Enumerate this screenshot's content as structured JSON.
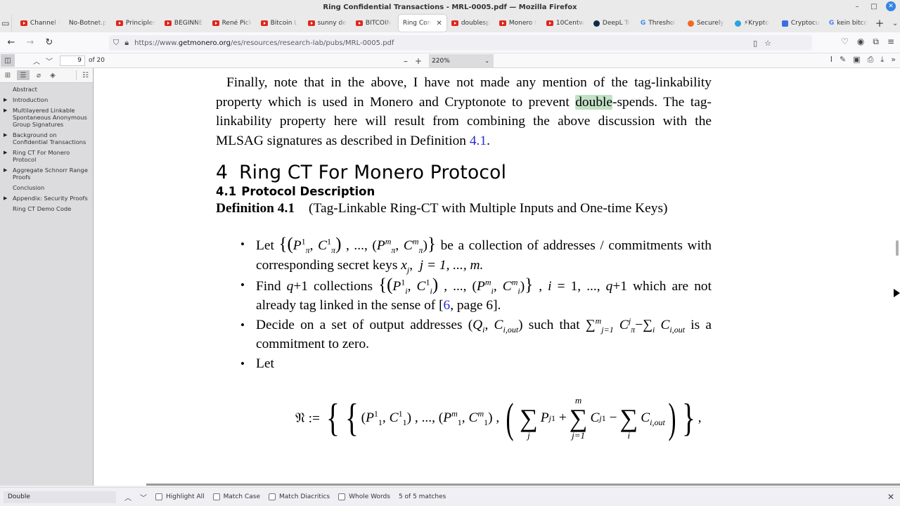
{
  "window": {
    "title": "Ring Confidential Transactions - MRL-0005.pdf — Mozilla Firefox",
    "controls": {
      "minimize": "–",
      "maximize": "□",
      "close": "✕"
    }
  },
  "tabs": [
    {
      "label": "Channel c",
      "icon": "youtube-icon",
      "active": false
    },
    {
      "label": "No-Botnet.p",
      "icon": "none",
      "active": false
    },
    {
      "label": "Principles",
      "icon": "youtube-icon",
      "active": false
    },
    {
      "label": "BEGINNE",
      "icon": "youtube-icon",
      "active": false
    },
    {
      "label": "René Pick",
      "icon": "youtube-icon",
      "active": false
    },
    {
      "label": "Bitcoin L",
      "icon": "youtube-icon",
      "active": false
    },
    {
      "label": "sunny de",
      "icon": "youtube-icon",
      "active": false
    },
    {
      "label": "BITCOIN",
      "icon": "youtube-icon",
      "active": false
    },
    {
      "label": "Ring Confi",
      "icon": "none",
      "active": true
    },
    {
      "label": "doublesp",
      "icon": "youtube-icon",
      "active": false
    },
    {
      "label": "Monero f",
      "icon": "youtube-icon",
      "active": false
    },
    {
      "label": "10Centw",
      "icon": "youtube-icon",
      "active": false
    },
    {
      "label": "DeepL Tr",
      "icon": "deepl-icon",
      "active": false
    },
    {
      "label": "Threshol",
      "icon": "google-icon",
      "active": false
    },
    {
      "label": "Securely",
      "icon": "monero-icon",
      "active": false
    },
    {
      "label": "⚡Krypto",
      "icon": "telegram-icon",
      "active": false
    },
    {
      "label": "Cryptocu",
      "icon": "cryptocurrency-icon",
      "active": false
    },
    {
      "label": "kein bitco",
      "icon": "google-icon",
      "active": false
    }
  ],
  "tab_close": "✕",
  "new_tab": "+",
  "tab_menu": "⌄",
  "nav": {
    "back": "←",
    "forward": "→",
    "reload": "↻",
    "url_prefix": "https://www.",
    "url_domain": "getmonero.org",
    "url_path": "/es/resources/research-lab/pubs/MRL-0005.pdf"
  },
  "pdf_toolbar": {
    "page_current": "9",
    "page_total_label": "of 20",
    "zoom_minus": "–",
    "zoom_plus": "+",
    "zoom_value": "220%"
  },
  "outline": [
    {
      "label": "Abstract",
      "expandable": false
    },
    {
      "label": "Introduction",
      "expandable": true
    },
    {
      "label": "Multilayered Linkable Spontaneous Anonymous Group Signatures",
      "expandable": true
    },
    {
      "label": "Background on Confidential Transactions",
      "expandable": true
    },
    {
      "label": "Ring CT For Monero Protocol",
      "expandable": true
    },
    {
      "label": "Aggregate Schnorr Range Proofs",
      "expandable": true
    },
    {
      "label": "Conclusion",
      "expandable": false
    },
    {
      "label": "Appendix: Security Proofs",
      "expandable": true
    },
    {
      "label": "Ring CT Demo Code",
      "expandable": false
    }
  ],
  "document": {
    "para1_a": "Finally, note that in the above, I have not made any mention of the tag-linkability property which is used in Monero and Cryptonote to prevent ",
    "para1_match": "double",
    "para1_b": "-spends. The tag-linkability property here will result from combining the above discussion with the MLSAG signatures as described in Definition ",
    "para1_link": "4.1",
    "para1_end": ".",
    "section_num": "4",
    "section_title": "Ring CT For Monero Protocol",
    "subsection_num": "4.1",
    "subsection_title": "Protocol Description",
    "definition_label": "Definition 4.1",
    "definition_title": "(Tag-Linkable Ring-CT with Multiple Inputs and One-time Keys)",
    "bullet1_a": "Let",
    "bullet1_b": "be a collection of addresses / commitments with corresponding secret keys",
    "bullet1_c": "j = 1, ..., m.",
    "bullet2_a": "Find",
    "bullet2_b": "collections",
    "bullet2_c": "which are not already tag linked in the sense of [",
    "bullet2_link": "6",
    "bullet2_d": ", page 6].",
    "bullet3_a": "Decide on a set of output addresses",
    "bullet3_b": "such that",
    "bullet3_c": "is a commitment to zero.",
    "bullet4": "Let",
    "tail": "....",
    "search_match_color": "#a5d6a7",
    "link_color": "#2a2ad4"
  },
  "findbar": {
    "query": "Double",
    "options": [
      {
        "label": "Highlight All",
        "checked": false
      },
      {
        "label": "Match Case",
        "checked": false
      },
      {
        "label": "Match Diacritics",
        "checked": false
      },
      {
        "label": "Whole Words",
        "checked": false
      }
    ],
    "status": "5 of 5 matches",
    "close": "✕"
  }
}
